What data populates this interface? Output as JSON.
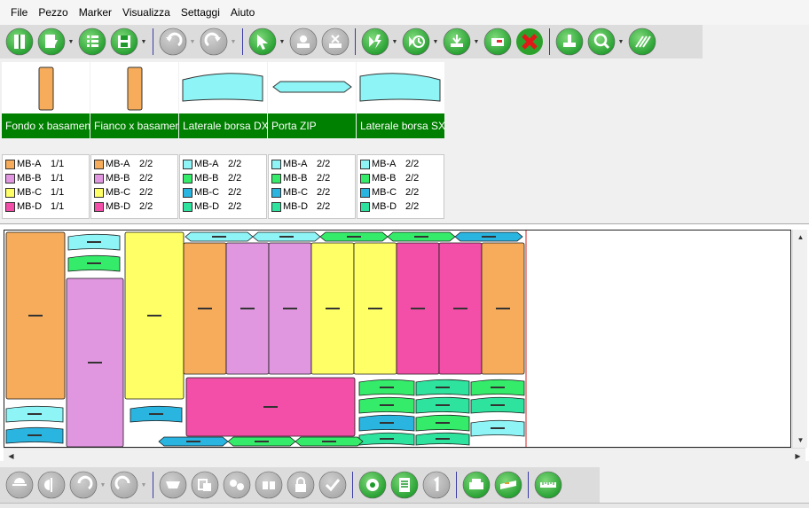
{
  "menu": [
    "File",
    "Pezzo",
    "Marker",
    "Visualizza",
    "Settaggi",
    "Aiuto"
  ],
  "toolbar_top": [
    {
      "name": "open-piece-icon",
      "color": "#1e9a2a",
      "enabled": true,
      "dropdown": false,
      "sep_after": false
    },
    {
      "name": "import-piece-icon",
      "color": "#1e9a2a",
      "enabled": true,
      "dropdown": true,
      "sep_after": false
    },
    {
      "name": "list-icon",
      "color": "#1e9a2a",
      "enabled": true,
      "dropdown": false,
      "sep_after": false
    },
    {
      "name": "save-icon",
      "color": "#1e9a2a",
      "enabled": true,
      "dropdown": true,
      "sep_after": true
    },
    {
      "name": "undo-icon",
      "color": "#a8a8a8",
      "enabled": false,
      "dropdown": true,
      "sep_after": false
    },
    {
      "name": "redo-icon",
      "color": "#a8a8a8",
      "enabled": false,
      "dropdown": true,
      "sep_after": true
    },
    {
      "name": "select-arrow-icon",
      "color": "#1e9a2a",
      "enabled": true,
      "dropdown": true,
      "sep_after": false
    },
    {
      "name": "add-piece-icon",
      "color": "#a8a8a8",
      "enabled": false,
      "dropdown": false,
      "sep_after": false
    },
    {
      "name": "remove-piece-icon",
      "color": "#a8a8a8",
      "enabled": false,
      "dropdown": false,
      "sep_after": true
    },
    {
      "name": "auto-nest-icon",
      "color": "#1e9a2a",
      "enabled": true,
      "dropdown": true,
      "sep_after": false
    },
    {
      "name": "timer-nest-icon",
      "color": "#1e9a2a",
      "enabled": true,
      "dropdown": true,
      "sep_after": false
    },
    {
      "name": "compact-icon",
      "color": "#1e9a2a",
      "enabled": true,
      "dropdown": true,
      "sep_after": false
    },
    {
      "name": "export-icon",
      "color": "#1e9a2a",
      "enabled": true,
      "dropdown": false,
      "sep_after": false
    },
    {
      "name": "delete-icon",
      "color": "#1e9a2a",
      "enabled": true,
      "dropdown": false,
      "sep_after": true
    },
    {
      "name": "stamp-icon",
      "color": "#1e9a2a",
      "enabled": true,
      "dropdown": false,
      "sep_after": false
    },
    {
      "name": "zoom-icon",
      "color": "#1e9a2a",
      "enabled": true,
      "dropdown": true,
      "sep_after": false
    },
    {
      "name": "hatch-icon",
      "color": "#1e9a2a",
      "enabled": true,
      "dropdown": false,
      "sep_after": false
    }
  ],
  "toolbar_bottom": [
    {
      "name": "flip-horizontal-icon",
      "color": "#a8a8a8",
      "enabled": false,
      "dropdown": false,
      "sep_after": false
    },
    {
      "name": "flip-vertical-icon",
      "color": "#a8a8a8",
      "enabled": false,
      "dropdown": false,
      "sep_after": false
    },
    {
      "name": "rotate-left-icon",
      "color": "#a8a8a8",
      "enabled": false,
      "dropdown": true,
      "sep_after": false
    },
    {
      "name": "rotate-right-icon",
      "color": "#a8a8a8",
      "enabled": false,
      "dropdown": true,
      "sep_after": true
    },
    {
      "name": "move-icon",
      "color": "#a8a8a8",
      "enabled": false,
      "dropdown": false,
      "sep_after": false
    },
    {
      "name": "copy-icon",
      "color": "#a8a8a8",
      "enabled": false,
      "dropdown": false,
      "sep_after": false
    },
    {
      "name": "group-icon",
      "color": "#a8a8a8",
      "enabled": false,
      "dropdown": false,
      "sep_after": false
    },
    {
      "name": "split-icon",
      "color": "#a8a8a8",
      "enabled": false,
      "dropdown": false,
      "sep_after": false
    },
    {
      "name": "lock-icon",
      "color": "#a8a8a8",
      "enabled": false,
      "dropdown": false,
      "sep_after": false
    },
    {
      "name": "check-icon",
      "color": "#a8a8a8",
      "enabled": false,
      "dropdown": false,
      "sep_after": true
    },
    {
      "name": "settings-gear-icon",
      "color": "#1e9a2a",
      "enabled": true,
      "dropdown": false,
      "sep_after": false
    },
    {
      "name": "report-icon",
      "color": "#1e9a2a",
      "enabled": true,
      "dropdown": false,
      "sep_after": false
    },
    {
      "name": "number-one-icon",
      "color": "#a8a8a8",
      "enabled": false,
      "dropdown": false,
      "sep_after": true
    },
    {
      "name": "print-icon",
      "color": "#1e9a2a",
      "enabled": true,
      "dropdown": false,
      "sep_after": false
    },
    {
      "name": "plotter-icon",
      "color": "#1e9a2a",
      "enabled": true,
      "dropdown": false,
      "sep_after": true
    },
    {
      "name": "ruler-icon",
      "color": "#1e9a2a",
      "enabled": true,
      "dropdown": false,
      "sep_after": false
    }
  ],
  "size_colors": {
    "orange": "#f6ac5a",
    "violet": "#e097e0",
    "yellow": "#ffff66",
    "pink": "#f44fa8",
    "cyan": "#8ef4f6",
    "green": "#35ec6a",
    "blue": "#2ab4e0",
    "seagreen": "#2ee39e"
  },
  "pieces": [
    {
      "name": "Fondo x basamento",
      "shape": "rect-tall",
      "color": "#f6ac5a",
      "sizes": [
        {
          "code": "MB-A",
          "qty": "1/1",
          "color": "#f6ac5a"
        },
        {
          "code": "MB-B",
          "qty": "1/1",
          "color": "#e097e0"
        },
        {
          "code": "MB-C",
          "qty": "1/1",
          "color": "#ffff66"
        },
        {
          "code": "MB-D",
          "qty": "1/1",
          "color": "#f44fa8"
        }
      ]
    },
    {
      "name": "Fianco x basamento",
      "shape": "rect-tall",
      "color": "#f6ac5a",
      "sizes": [
        {
          "code": "MB-A",
          "qty": "2/2",
          "color": "#f6ac5a"
        },
        {
          "code": "MB-B",
          "qty": "2/2",
          "color": "#e097e0"
        },
        {
          "code": "MB-C",
          "qty": "2/2",
          "color": "#ffff66"
        },
        {
          "code": "MB-D",
          "qty": "2/2",
          "color": "#f44fa8"
        }
      ]
    },
    {
      "name": "Laterale borsa DX",
      "shape": "curved-wide",
      "color": "#8ef4f6",
      "sizes": [
        {
          "code": "MB-A",
          "qty": "2/2",
          "color": "#8ef4f6"
        },
        {
          "code": "MB-B",
          "qty": "2/2",
          "color": "#35ec6a"
        },
        {
          "code": "MB-C",
          "qty": "2/2",
          "color": "#2ab4e0"
        },
        {
          "code": "MB-D",
          "qty": "2/2",
          "color": "#2ee39e"
        }
      ]
    },
    {
      "name": "Porta ZIP",
      "shape": "strip",
      "color": "#8ef4f6",
      "sizes": [
        {
          "code": "MB-A",
          "qty": "2/2",
          "color": "#8ef4f6"
        },
        {
          "code": "MB-B",
          "qty": "2/2",
          "color": "#35ec6a"
        },
        {
          "code": "MB-C",
          "qty": "2/2",
          "color": "#2ab4e0"
        },
        {
          "code": "MB-D",
          "qty": "2/2",
          "color": "#2ee39e"
        }
      ]
    },
    {
      "name": "Laterale borsa SX",
      "shape": "curved-wide-flip",
      "color": "#8ef4f6",
      "sizes": [
        {
          "code": "MB-A",
          "qty": "2/2",
          "color": "#8ef4f6"
        },
        {
          "code": "MB-B",
          "qty": "2/2",
          "color": "#35ec6a"
        },
        {
          "code": "MB-C",
          "qty": "2/2",
          "color": "#2ab4e0"
        },
        {
          "code": "MB-D",
          "qty": "2/2",
          "color": "#2ee39e"
        }
      ]
    }
  ],
  "marker_pieces": [
    {
      "kind": "rect",
      "color": "#f6ac5a"
    },
    {
      "kind": "rect",
      "color": "#e097e0"
    },
    {
      "kind": "rect",
      "color": "#ffff66"
    },
    {
      "kind": "rect",
      "color": "#f6ac5a"
    },
    {
      "kind": "rect",
      "color": "#e097e0"
    },
    {
      "kind": "rect",
      "color": "#e097e0"
    },
    {
      "kind": "rect",
      "color": "#ffff66"
    },
    {
      "kind": "rect",
      "color": "#ffff66"
    },
    {
      "kind": "rect",
      "color": "#f44fa8"
    },
    {
      "kind": "rect",
      "color": "#f44fa8"
    },
    {
      "kind": "rect",
      "color": "#f6ac5a"
    },
    {
      "kind": "rect",
      "color": "#f44fa8"
    },
    {
      "kind": "curved",
      "color": "#8ef4f6"
    },
    {
      "kind": "curved",
      "color": "#35ec6a"
    },
    {
      "kind": "curved",
      "color": "#2ab4e0"
    },
    {
      "kind": "curved",
      "color": "#8ef4f6"
    },
    {
      "kind": "curved",
      "color": "#2ab4e0"
    },
    {
      "kind": "curved",
      "color": "#35ec6a"
    },
    {
      "kind": "curved",
      "color": "#35ec6a"
    },
    {
      "kind": "curved",
      "color": "#2ab4e0"
    },
    {
      "kind": "curved",
      "color": "#2ee39e"
    },
    {
      "kind": "curved",
      "color": "#2ee39e"
    },
    {
      "kind": "curved",
      "color": "#2ee39e"
    },
    {
      "kind": "curved",
      "color": "#35ec6a"
    },
    {
      "kind": "curved",
      "color": "#2ee39e"
    },
    {
      "kind": "curved",
      "color": "#35ec6a"
    },
    {
      "kind": "curved",
      "color": "#2ee39e"
    },
    {
      "kind": "curved",
      "color": "#8ef4f6"
    },
    {
      "kind": "curved",
      "color": "#2ab4e0"
    },
    {
      "kind": "curved",
      "color": "#35ec6a"
    },
    {
      "kind": "curved",
      "color": "#8ef4f6"
    },
    {
      "kind": "curved",
      "color": "#2ab4e0"
    },
    {
      "kind": "strip",
      "color": "#8ef4f6"
    },
    {
      "kind": "strip",
      "color": "#8ef4f6"
    },
    {
      "kind": "strip",
      "color": "#35ec6a"
    },
    {
      "kind": "strip",
      "color": "#35ec6a"
    },
    {
      "kind": "strip",
      "color": "#2ab4e0"
    },
    {
      "kind": "strip",
      "color": "#2ab4e0"
    },
    {
      "kind": "strip",
      "color": "#35ec6a"
    },
    {
      "kind": "strip",
      "color": "#35ec6a"
    }
  ]
}
